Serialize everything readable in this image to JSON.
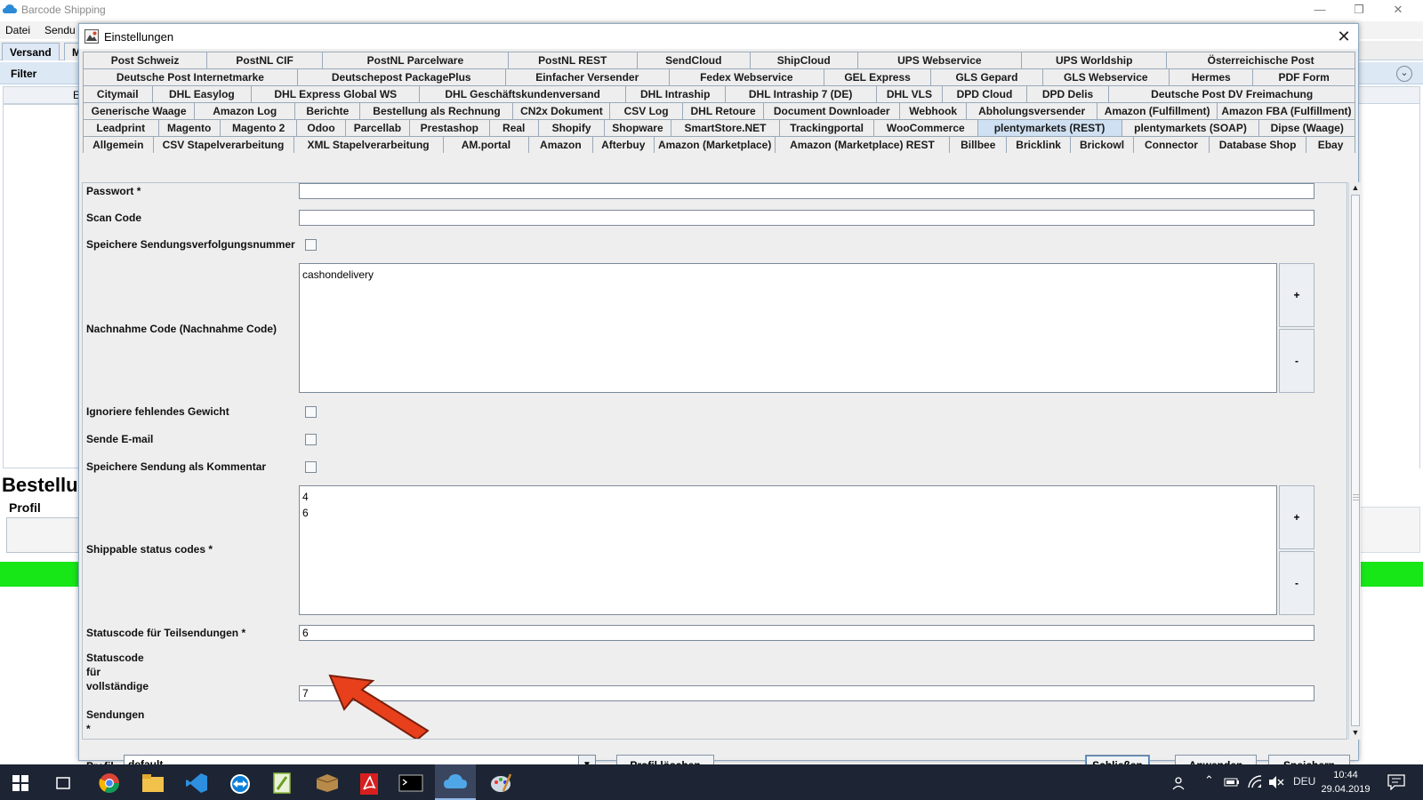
{
  "app": {
    "title": "Barcode Shipping",
    "menu": [
      "Datei",
      "Sendu"
    ],
    "tabs": [
      "Versand",
      "M"
    ],
    "filter_label": "Filter",
    "left_letter": "E",
    "section_title": "Bestellu",
    "profile_label": "Profil"
  },
  "dialog": {
    "title": "Einstellungen",
    "tab_rows": [
      [
        "Post Schweiz",
        "PostNL CIF",
        "PostNL Parcelware",
        "PostNL REST",
        "SendCloud",
        "ShipCloud",
        "UPS Webservice",
        "UPS Worldship",
        "Österreichische Post"
      ],
      [
        "Deutsche Post Internetmarke",
        "Deutschepost PackagePlus",
        "Einfacher Versender",
        "Fedex Webservice",
        "GEL Express",
        "GLS Gepard",
        "GLS Webservice",
        "Hermes",
        "PDF Form"
      ],
      [
        "Citymail",
        "DHL Easylog",
        "DHL Express Global WS",
        "DHL Geschäftskundenversand",
        "DHL Intraship",
        "DHL Intraship 7 (DE)",
        "DHL VLS",
        "DPD Cloud",
        "DPD Delis",
        "Deutsche Post DV Freimachung"
      ],
      [
        "Generische Waage",
        "Amazon Log",
        "Berichte",
        "Bestellung als Rechnung",
        "CN2x Dokument",
        "CSV Log",
        "DHL Retoure",
        "Document Downloader",
        "Webhook",
        "Abholungsversender",
        "Amazon (Fulfillment)",
        "Amazon FBA (Fulfillment)"
      ],
      [
        "Leadprint",
        "Magento",
        "Magento 2",
        "Odoo",
        "Parcellab",
        "Prestashop",
        "Real",
        "Shopify",
        "Shopware",
        "SmartStore.NET",
        "Trackingportal",
        "WooCommerce",
        "plentymarkets (REST)",
        "plentymarkets (SOAP)",
        "Dipse (Waage)"
      ],
      [
        "Allgemein",
        "CSV Stapelverarbeitung",
        "XML Stapelverarbeitung",
        "AM.portal",
        "Amazon",
        "Afterbuy",
        "Amazon (Marketplace)",
        "Amazon (Marketplace) REST",
        "Billbee",
        "Bricklink",
        "Brickowl",
        "Connector",
        "Database Shop",
        "Ebay"
      ]
    ],
    "active_tab": "plentymarkets (REST)",
    "fields": {
      "passwort_label": "Passwort *",
      "passwort_value": "",
      "scan_code_label": "Scan Code",
      "scan_code_value": "",
      "speichere_tracking_label": "Speichere Sendungsverfolgungsnummer",
      "nachnahme_label": "Nachnahme Code (Nachnahme Code)",
      "nachnahme_values": "cashondelivery",
      "ignoriere_gewicht_label": "Ignoriere fehlendes Gewicht",
      "sende_email_label": "Sende E-mail",
      "speichere_kommentar_label": "Speichere Sendung als Kommentar",
      "shippable_label": "Shippable status codes *",
      "shippable_values": "4\n6",
      "teilsendungen_label": "Statuscode für Teilsendungen *",
      "teilsendungen_value": "6",
      "vollstaendig_label_1": "Statuscode",
      "vollstaendig_label_2": "für",
      "vollstaendig_label_3": "vollständige",
      "vollstaendig_label_4": "Sendungen",
      "vollstaendig_label_5": "*",
      "vollstaendig_value": "7"
    },
    "list_buttons": {
      "add": "+",
      "remove": "-"
    },
    "footer": {
      "profile_label": "Profil",
      "profile_value": "default",
      "delete_profile": "Profil löschen",
      "close": "Schließen",
      "apply": "Anwenden",
      "save": "Speichern"
    }
  },
  "taskbar": {
    "language": "DEU",
    "time": "10:44",
    "date": "29.04.2019"
  },
  "colors": {
    "active_tab": "#cfe0f2",
    "status_green": "#17e617",
    "arrow": "#e8401c",
    "taskbar": "#1d2433"
  }
}
